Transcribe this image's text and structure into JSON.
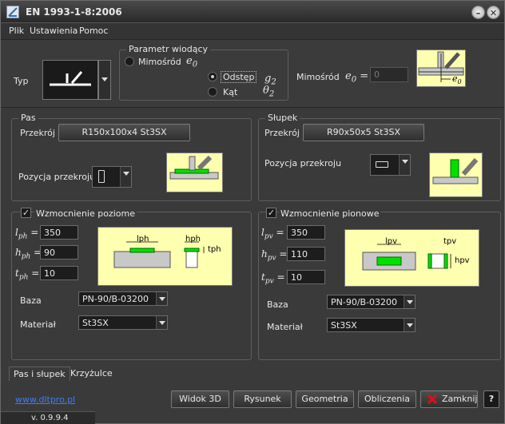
{
  "window": {
    "title": "EN 1993-1-8:2006"
  },
  "menu": {
    "file": "Plik",
    "settings": "Ustawienia",
    "help": "Pomoc"
  },
  "top": {
    "typ_label": "Typ",
    "param_group": "Parametr wiodący",
    "mimosrod_label": "Mimośród",
    "e0_sym": "e",
    "e0_sub": "0",
    "odstep_label": "Odstęp",
    "g2_sym": "g",
    "g2_sub": "2",
    "kat_label": "Kąt",
    "theta_sym": "θ",
    "theta_sub": "2",
    "mimosrod_right_label": "Mimośród",
    "e0_eq": "=",
    "e0_value": "0",
    "diagram_label_sym": "e",
    "diagram_label_sub": "0"
  },
  "pas": {
    "group": "Pas",
    "przekroj_label": "Przekrój",
    "przekroj_value": "R150x100x4  St3SX",
    "pozycja_label": "Pozycja przekroju",
    "wzmocnienie_label": "Wzmocnienie poziome",
    "rows": [
      {
        "sym": "l",
        "sub": "ph",
        "eq": "=",
        "value": "350"
      },
      {
        "sym": "h",
        "sub": "ph",
        "eq": "=",
        "value": "90"
      },
      {
        "sym": "t",
        "sub": "ph",
        "eq": "=",
        "value": "10"
      }
    ],
    "baza_label": "Baza",
    "baza_value": "PN-90/B-03200",
    "material_label": "Materiał",
    "material_value": "St3SX",
    "dia_lph": "lph",
    "dia_hph": "hph",
    "dia_tph": "tph"
  },
  "slupek": {
    "group": "Słupek",
    "przekroj_label": "Przekrój",
    "przekroj_value": "R90x50x5  St3SX",
    "pozycja_label": "Pozycja przekroju",
    "wzmocnienie_label": "Wzmocnienie pionowe",
    "rows": [
      {
        "sym": "l",
        "sub": "pv",
        "eq": "=",
        "value": "350"
      },
      {
        "sym": "h",
        "sub": "pv",
        "eq": "=",
        "value": "110"
      },
      {
        "sym": "t",
        "sub": "pv",
        "eq": "=",
        "value": "10"
      }
    ],
    "baza_label": "Baza",
    "baza_value": "PN-90/B-03200",
    "material_label": "Materiał",
    "material_value": "St3SX",
    "dia_lpv": "lpv",
    "dia_tpv": "tpv",
    "dia_hpv": "hpv"
  },
  "tabs": {
    "pas_slupek": "Pas i słupek",
    "krzyzulce": "Krzyżulce"
  },
  "footer": {
    "link": "www.dltpro.pl",
    "version": "v. 0.9.9.4",
    "widok3d": "Widok 3D",
    "rysunek": "Rysunek",
    "geometria": "Geometria",
    "obliczenia": "Obliczenia",
    "zamknij": "Zamknij",
    "help": "?"
  },
  "colors": {
    "accent_green": "#00e000",
    "diagram_bg": "#ffffb0",
    "link": "#3a7dff",
    "close_red": "#e01010"
  }
}
